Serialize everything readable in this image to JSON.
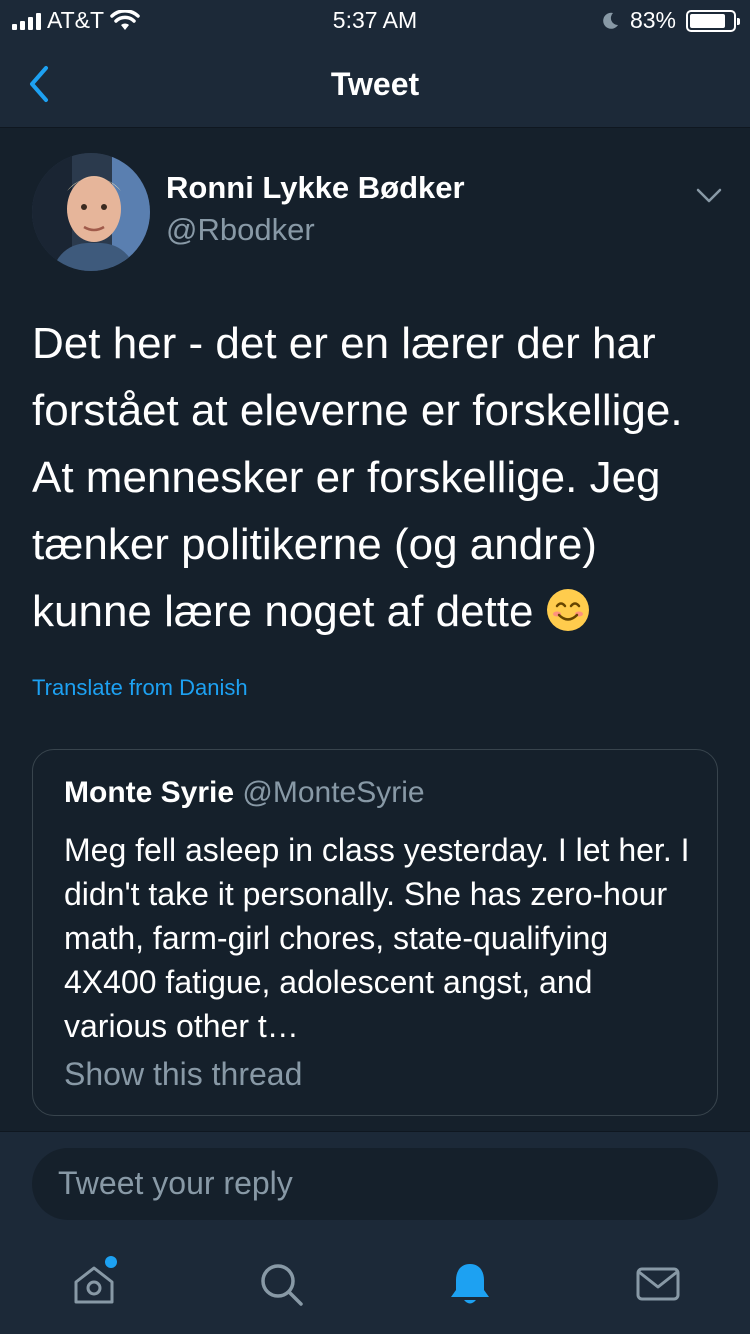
{
  "status_bar": {
    "carrier": "AT&T",
    "time": "5:37 AM",
    "battery": "83%",
    "battery_level": 0.83
  },
  "nav": {
    "title": "Tweet",
    "back_icon": "chevron-left-icon"
  },
  "tweet": {
    "author_name": "Ronni Lykke Bødker",
    "author_handle": "@Rbodker",
    "text": "Det her - det er en lærer der har forstået at eleverne er forskellige. At mennesker er forskellige. Jeg tænker politikerne (og andre) kunne lære noget af dette",
    "translate_label": "Translate from Danish"
  },
  "quote": {
    "name": "Monte Syrie",
    "handle": "@MonteSyrie",
    "text": "Meg fell asleep in class yesterday. I let her. I didn't take it personally. She has zero-hour math, farm-girl chores, state-qualifying 4X400 fatigue, adolescent angst, and various other t…",
    "show_thread": "Show this thread"
  },
  "reply": {
    "placeholder": "Tweet your reply"
  },
  "tabs": [
    {
      "name": "home-icon"
    },
    {
      "name": "search-icon"
    },
    {
      "name": "notifications-icon"
    },
    {
      "name": "messages-icon"
    }
  ],
  "colors": {
    "background": "#15202b",
    "bar": "#1c2938",
    "accent": "#1da1f2",
    "secondary_text": "#8899a6"
  }
}
